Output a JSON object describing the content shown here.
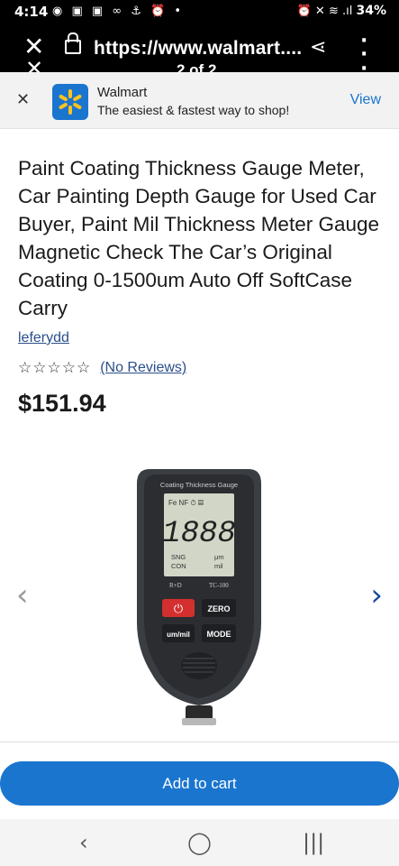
{
  "status_bar": {
    "time": "4:14",
    "notification_icons": "◉ ▣ ▣ ∞ ⚓ ⏰ •",
    "system_icons": "⏰ ✕ ≋ .ıl",
    "battery": "34%"
  },
  "browser": {
    "url": "https://www.walmart....",
    "page_indicator": "2 of 2"
  },
  "app_banner": {
    "app_name": "Walmart",
    "tagline": "The easiest & fastest way to shop!",
    "view_label": "View"
  },
  "product": {
    "title": "Paint Coating Thickness Gauge Meter, Car Painting Depth Gauge for Used Car Buyer, Paint Mil Thickness Meter Gauge Magnetic Check The Car’s Original Coating 0-1500um Auto Off SoftCase Carry",
    "seller": "leferydd",
    "stars": "☆☆☆☆☆",
    "reviews": "(No Reviews)",
    "price": "$151.94"
  },
  "device": {
    "header": "Coating Thickness Gauge",
    "top_row": "Fe NF ⏱ ▤",
    "reading": "1888",
    "sng": "SNG",
    "con": "CON",
    "unit_um": "μm",
    "unit_mil": "mil",
    "brand": "R+D",
    "model": "TC-100",
    "power_symbol": "⏻",
    "zero_label": "ZERO",
    "unit_label": "um/mil",
    "mode_label": "MODE"
  },
  "gallery": {
    "prev_icon": "‹",
    "next_icon": "›"
  },
  "actions": {
    "add_to_cart": "Add to cart"
  },
  "colors": {
    "accent": "#1a75cf",
    "link": "#2a4f8a",
    "power_button": "#d32f2f"
  }
}
